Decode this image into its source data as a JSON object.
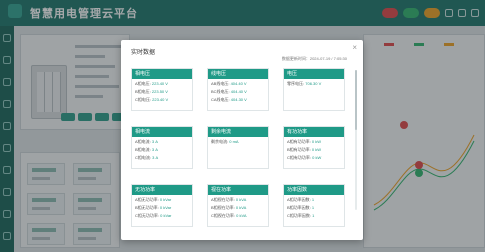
{
  "app": {
    "title": "智慧用电管理云平台"
  },
  "topbar": {
    "badge_1": "",
    "badge_2": "",
    "badge_3": ""
  },
  "modal": {
    "title": "实时数据",
    "close_glyph": "×",
    "update_text": "数据更新时间：2024-07-19 / 7:05:30",
    "cards": [
      {
        "title": "相电压",
        "rows": [
          {
            "label": "A相电压:",
            "value": "223.40 V"
          },
          {
            "label": "B相电压:",
            "value": "223.50 V"
          },
          {
            "label": "C相电压:",
            "value": "223.40 V"
          }
        ]
      },
      {
        "title": "线电压",
        "rows": [
          {
            "label": "AB线电压:",
            "value": "404.40 V"
          },
          {
            "label": "BC线电压:",
            "value": "404.40 V"
          },
          {
            "label": "CA线电压:",
            "value": "404.30 V"
          }
        ]
      },
      {
        "title": "电压",
        "rows": [
          {
            "label": "零序电压:",
            "value": "706.30 V"
          }
        ]
      },
      {
        "title": "相电流",
        "rows": [
          {
            "label": "A相电流:",
            "value": "3 A"
          },
          {
            "label": "B相电流:",
            "value": "3 A"
          },
          {
            "label": "C相电流:",
            "value": "3 A"
          }
        ]
      },
      {
        "title": "剩余电流",
        "rows": [
          {
            "label": "剩余电流:",
            "value": "0 mA"
          }
        ]
      },
      {
        "title": "有功功率",
        "rows": [
          {
            "label": "A相有功功率:",
            "value": "0 kW"
          },
          {
            "label": "B相有功功率:",
            "value": "0 kW"
          },
          {
            "label": "C相有功功率:",
            "value": "0 kW"
          }
        ]
      },
      {
        "title": "无功功率",
        "rows": [
          {
            "label": "A相无功功率:",
            "value": "0 kVar"
          },
          {
            "label": "B相无功功率:",
            "value": "0 kVar"
          },
          {
            "label": "C相无功功率:",
            "value": "0 kVar"
          }
        ]
      },
      {
        "title": "视在功率",
        "rows": [
          {
            "label": "A相视在功率:",
            "value": "0 kVA"
          },
          {
            "label": "B相视在功率:",
            "value": "0 kVA"
          },
          {
            "label": "C相视在功率:",
            "value": "0 kVA"
          }
        ]
      },
      {
        "title": "功率因数",
        "rows": [
          {
            "label": "A相功率因数:",
            "value": "1"
          },
          {
            "label": "B相功率因数:",
            "value": "1"
          },
          {
            "label": "C相功率因数:",
            "value": "1"
          }
        ]
      }
    ]
  },
  "colors": {
    "brand": "#1b7468",
    "accent": "#1f9a87",
    "alarm": "#e04545",
    "ok": "#2db36b"
  }
}
